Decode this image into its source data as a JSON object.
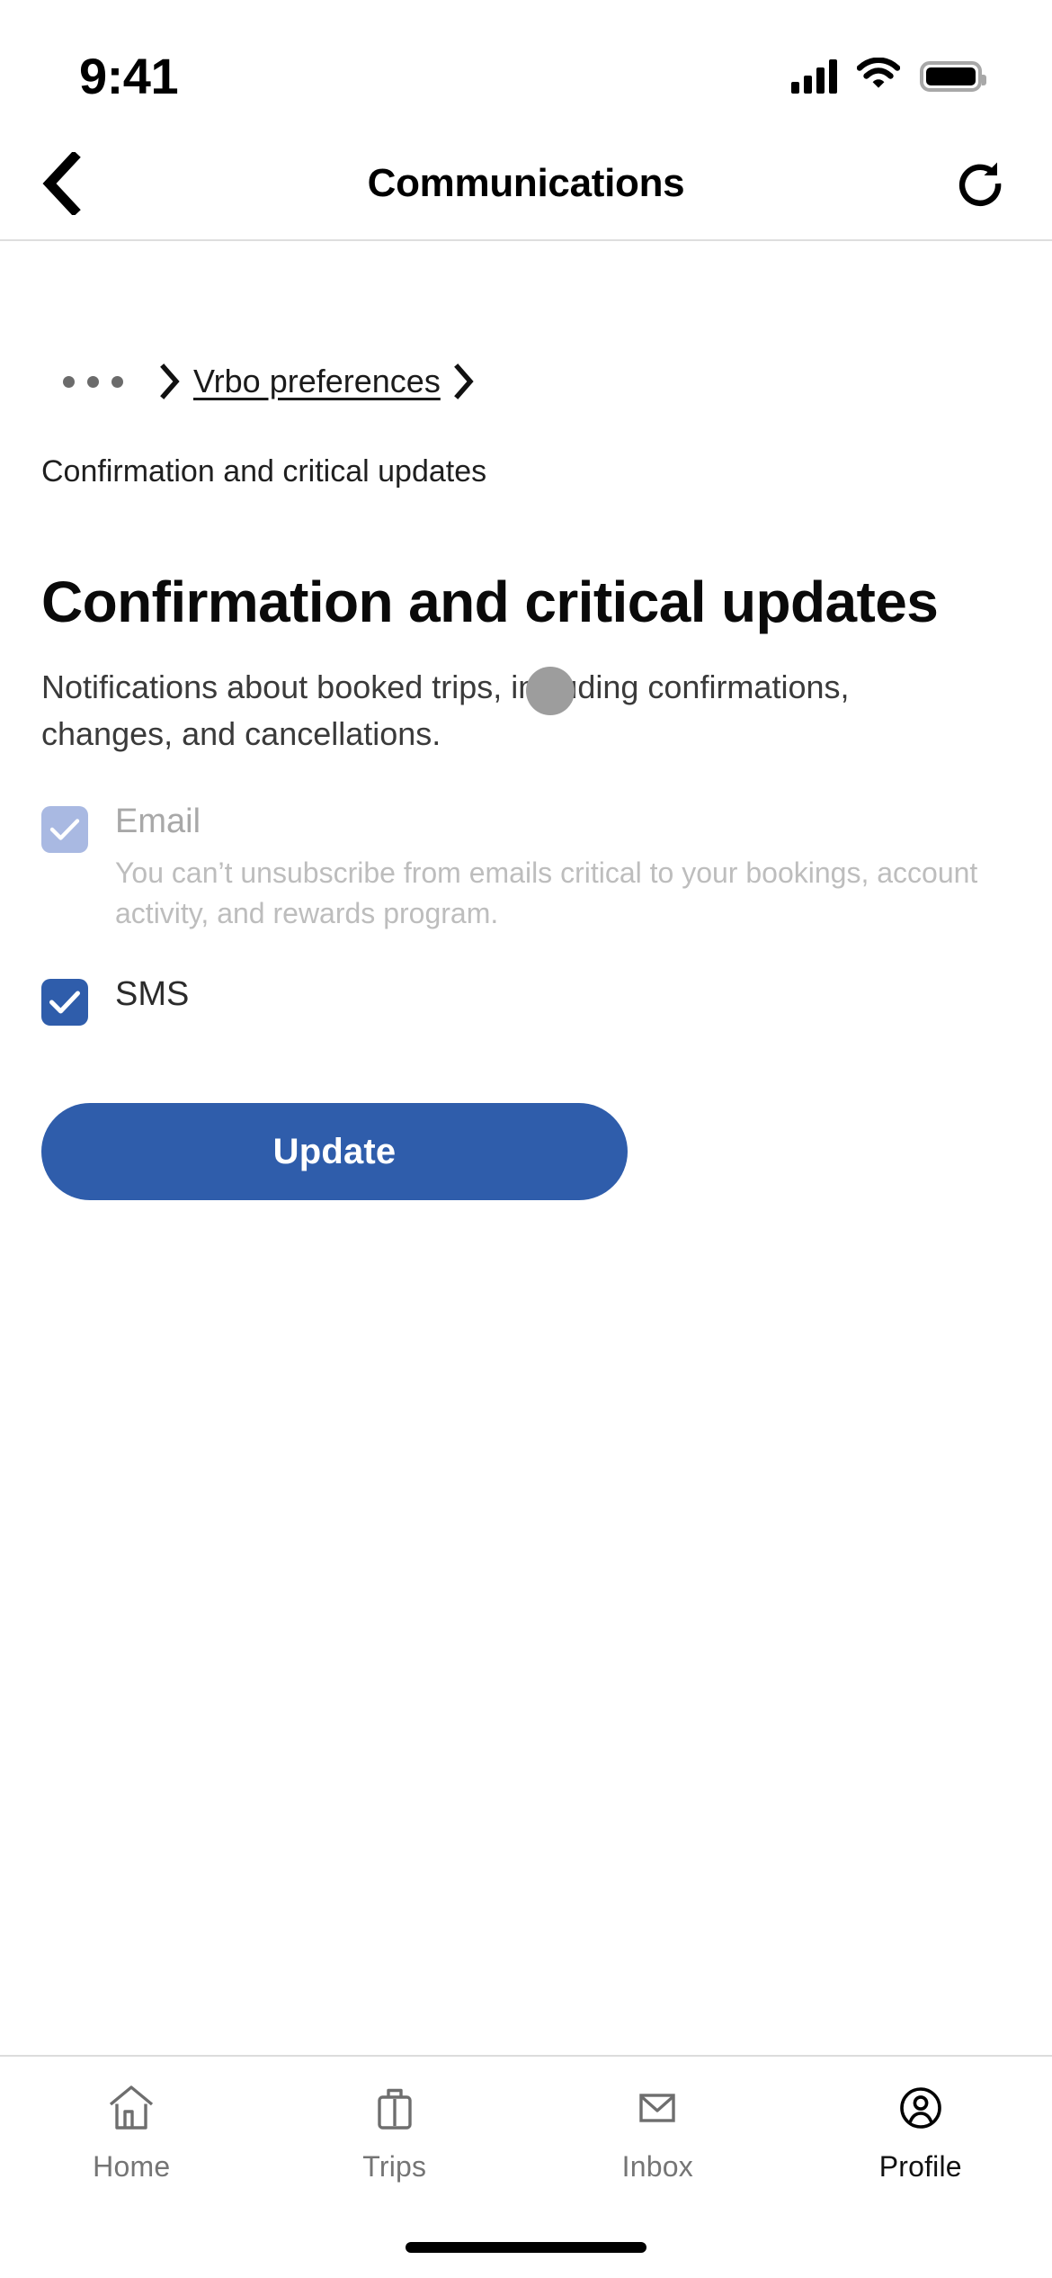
{
  "status_bar": {
    "time": "9:41",
    "signal_icon": "cellular-signal-icon",
    "wifi_icon": "wifi-icon",
    "battery_icon": "battery-full-icon"
  },
  "nav": {
    "back_icon": "chevron-left-icon",
    "title": "Communications",
    "refresh_icon": "refresh-icon"
  },
  "breadcrumb": {
    "overflow_icon": "ellipsis-icon",
    "separator_icon": "chevron-right-icon",
    "link_label": "Vrbo preferences",
    "current": "Confirmation and critical updates"
  },
  "main": {
    "title": "Confirmation and critical updates",
    "description": "Notifications about booked trips, including confirmations, changes, and cancellations.",
    "options": [
      {
        "label": "Email",
        "help": "You can’t unsubscribe from emails critical to your bookings, account activity, and rewards program.",
        "checked": true,
        "disabled": true,
        "check_icon": "checkmark-icon"
      },
      {
        "label": "SMS",
        "help": "",
        "checked": true,
        "disabled": false,
        "check_icon": "checkmark-icon"
      }
    ],
    "submit_label": "Update"
  },
  "tab_bar": {
    "items": [
      {
        "label": "Home",
        "icon": "home-icon",
        "active": false
      },
      {
        "label": "Trips",
        "icon": "suitcase-icon",
        "active": false
      },
      {
        "label": "Inbox",
        "icon": "envelope-icon",
        "active": false
      },
      {
        "label": "Profile",
        "icon": "person-circle-icon",
        "active": true
      }
    ]
  },
  "colors": {
    "accent_blue": "#2f5dab",
    "disabled_blue": "#a9b9e2",
    "muted_text": "#bdbdbd",
    "touch_indicator": "#9d9d9d"
  }
}
